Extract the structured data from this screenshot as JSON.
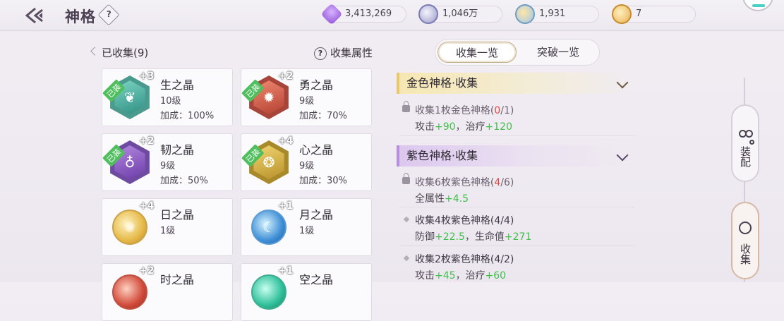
{
  "header": {
    "title": "神格",
    "help": "?",
    "resources": [
      {
        "icon": "purple-crystal-icon",
        "value": "3,413,269"
      },
      {
        "icon": "silver-coin-icon",
        "value": "1,046万"
      },
      {
        "icon": "blue-medal-icon",
        "value": "1,931"
      },
      {
        "icon": "gold-medal-icon",
        "value": "7"
      }
    ]
  },
  "left": {
    "collected_label": "已收集(9)",
    "attr_link": "收集属性",
    "attr_q": "?",
    "cards": [
      {
        "name": "生之晶",
        "level": "+3",
        "grade": "10级",
        "bonus": "加成：100%",
        "equipped": "已装"
      },
      {
        "name": "勇之晶",
        "level": "+2",
        "grade": "9级",
        "bonus": "加成：70%",
        "equipped": "已装"
      },
      {
        "name": "韧之晶",
        "level": "+2",
        "grade": "9级",
        "bonus": "加成：50%",
        "equipped": "已装"
      },
      {
        "name": "心之晶",
        "level": "+4",
        "grade": "9级",
        "bonus": "加成：30%",
        "equipped": "已装"
      },
      {
        "name": "日之晶",
        "level": "+4",
        "grade": "1级",
        "bonus": ""
      },
      {
        "name": "月之晶",
        "level": "+1",
        "grade": "1级",
        "bonus": ""
      },
      {
        "name": "时之晶",
        "level": "+2",
        "grade": "",
        "bonus": ""
      },
      {
        "name": "空之晶",
        "level": "+1",
        "grade": "",
        "bonus": ""
      }
    ]
  },
  "right": {
    "tabs": [
      "收集一览",
      "突破一览"
    ],
    "gold_section": {
      "title": "金色神格·收集",
      "reqs": [
        {
          "pre": "收集1枚金色神格(",
          "cur": "0",
          "post": "/1)",
          "stat1": "攻击",
          "v1": "+90",
          "sep": "，",
          "stat2": "治疗",
          "v2": "+120"
        }
      ]
    },
    "purple_section": {
      "title": "紫色神格·收集",
      "reqs": [
        {
          "pre": "收集6枚紫色神格(",
          "cur": "4",
          "post": "/6)",
          "stat1": "全属性",
          "v1": "+4.5"
        },
        {
          "pre": "收集4枚紫色神格(4/4)",
          "stat1": "防御",
          "v1": "+22.5",
          "sep": "，",
          "stat2": "生命值",
          "v2": "+271"
        },
        {
          "pre": "收集2枚紫色神格(4/2)",
          "stat1": "攻击",
          "v1": "+45",
          "sep": "，",
          "stat2": "治疗",
          "v2": "+60"
        }
      ]
    }
  },
  "side": {
    "equip": "装配",
    "collect": "收集"
  }
}
